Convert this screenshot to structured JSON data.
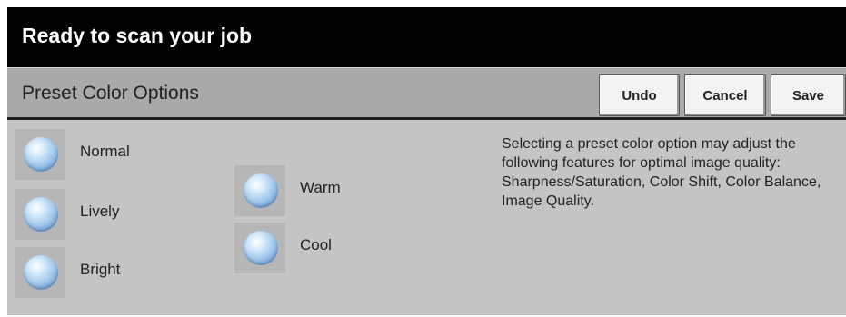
{
  "header": {
    "status": "Ready to scan your job"
  },
  "toolbar": {
    "title": "Preset Color Options",
    "undo_label": "Undo",
    "cancel_label": "Cancel",
    "save_label": "Save"
  },
  "options": {
    "normal": "Normal",
    "lively": "Lively",
    "bright": "Bright",
    "warm": "Warm",
    "cool": "Cool"
  },
  "description": "Selecting a preset color option may adjust the following features for optimal image quality: Sharpness/Saturation, Color Shift, Color Balance, Image Quality."
}
